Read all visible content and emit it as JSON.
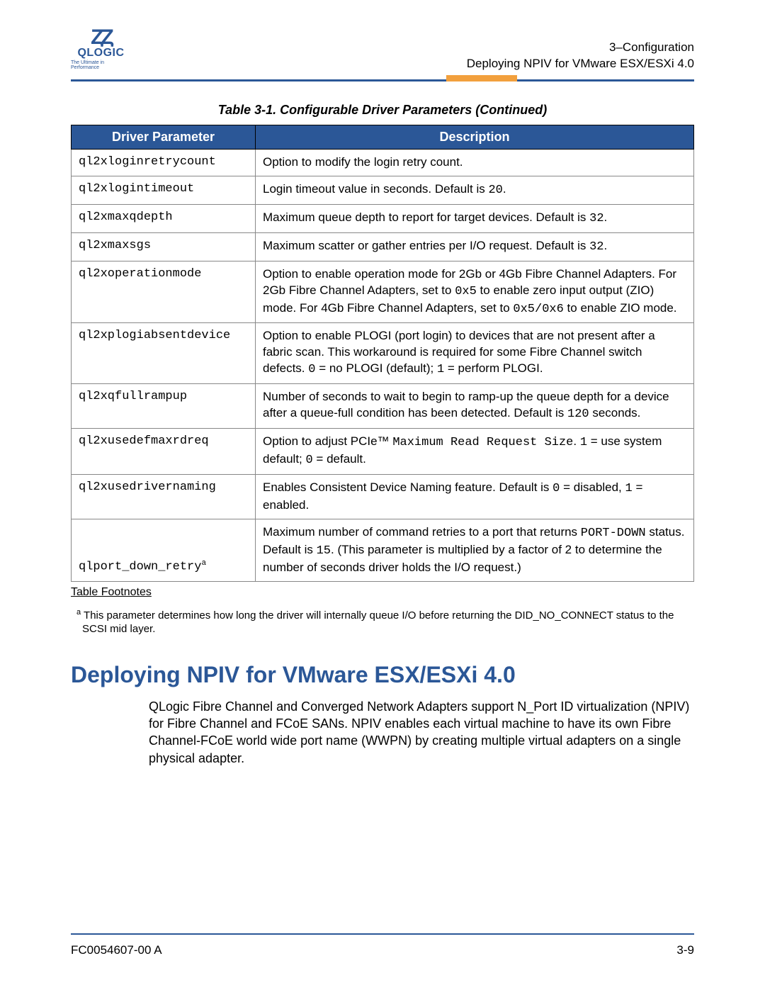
{
  "logo": {
    "name": "QLOGIC",
    "tagline": "The Ultimate in Performance"
  },
  "header": {
    "line1": "3–Configuration",
    "line2": "Deploying NPIV for VMware ESX/ESXi 4.0"
  },
  "table": {
    "caption": "Table 3-1. Configurable Driver Parameters (Continued)",
    "head_param": "Driver Parameter",
    "head_desc": "Description",
    "rows": [
      {
        "param": "ql2xloginretrycount",
        "desc_html": "Option to modify the login retry count."
      },
      {
        "param": "ql2xlogintimeout",
        "desc_html": "Login timeout value in seconds. Default is <span class=\"mono\">20</span>."
      },
      {
        "param": "ql2xmaxqdepth",
        "desc_html": "Maximum queue depth to report for target devices. Default is <span class=\"mono\">32</span>."
      },
      {
        "param": "ql2xmaxsgs",
        "desc_html": "Maximum scatter or gather entries per I/O request. Default is <span class=\"mono\">32</span>."
      },
      {
        "param": "ql2xoperationmode",
        "desc_html": "Option to enable operation mode for 2Gb or 4Gb Fibre Channel Adapters. For 2Gb Fibre Channel Adapters, set to <span class=\"mono\">0x5</span> to enable zero input output (ZIO) mode. For 4Gb Fibre Channel Adapters, set to <span class=\"mono\">0x5/0x6</span> to enable ZIO mode."
      },
      {
        "param": "ql2xplogiabsentdevice",
        "desc_html": "Option to enable PLOGI (port login) to devices that are not present after a fabric scan. This workaround is required for some Fibre Channel switch defects. <span class=\"mono\">0</span> = no PLOGI (default); <span class=\"mono\">1</span> = perform PLOGI."
      },
      {
        "param": "ql2xqfullrampup",
        "desc_html": "Number of seconds to wait to begin to ramp-up the queue depth for a device after a queue-full condition has been detected. Default is <span class=\"mono\">120</span> seconds."
      },
      {
        "param": "ql2xusedefmaxrdreq",
        "desc_html": "Option to adjust PCIe™ <span class=\"mono\">Maximum Read Request Size</span>. <span class=\"mono\">1</span> = use system default; <span class=\"mono\">0</span> = default."
      },
      {
        "param": "ql2xusedrivernaming",
        "desc_html": "Enables Consistent Device Naming feature. Default is <span class=\"mono\">0</span> = disabled, <span class=\"mono\">1</span> = enabled."
      },
      {
        "param": "qlport_down_retry",
        "ast": true,
        "valign_bottom": true,
        "desc_html": "Maximum number of command retries to a port that returns <span class=\"mono\">PORT-DOWN</span> status. Default is <span class=\"mono\">15</span>. (This parameter is multiplied by a factor of 2 to determine the number of seconds driver holds the I/O request.)"
      }
    ]
  },
  "footnotes": {
    "label": "Table Footnotes",
    "text": "This parameter determines how long the driver will internally queue I/O before returning the DID_NO_CONNECT status to the SCSI mid layer."
  },
  "section_heading": "Deploying NPIV for VMware ESX/ESXi 4.0",
  "body": "QLogic Fibre Channel and Converged Network Adapters support N_Port ID virtualization (NPIV) for Fibre Channel and FCoE SANs. NPIV enables each virtual machine to have its own Fibre Channel-FCoE world wide port name (WWPN) by creating multiple virtual adapters on a single physical adapter.",
  "footer": {
    "doc_id": "FC0054607-00  A",
    "page": "3-9"
  }
}
